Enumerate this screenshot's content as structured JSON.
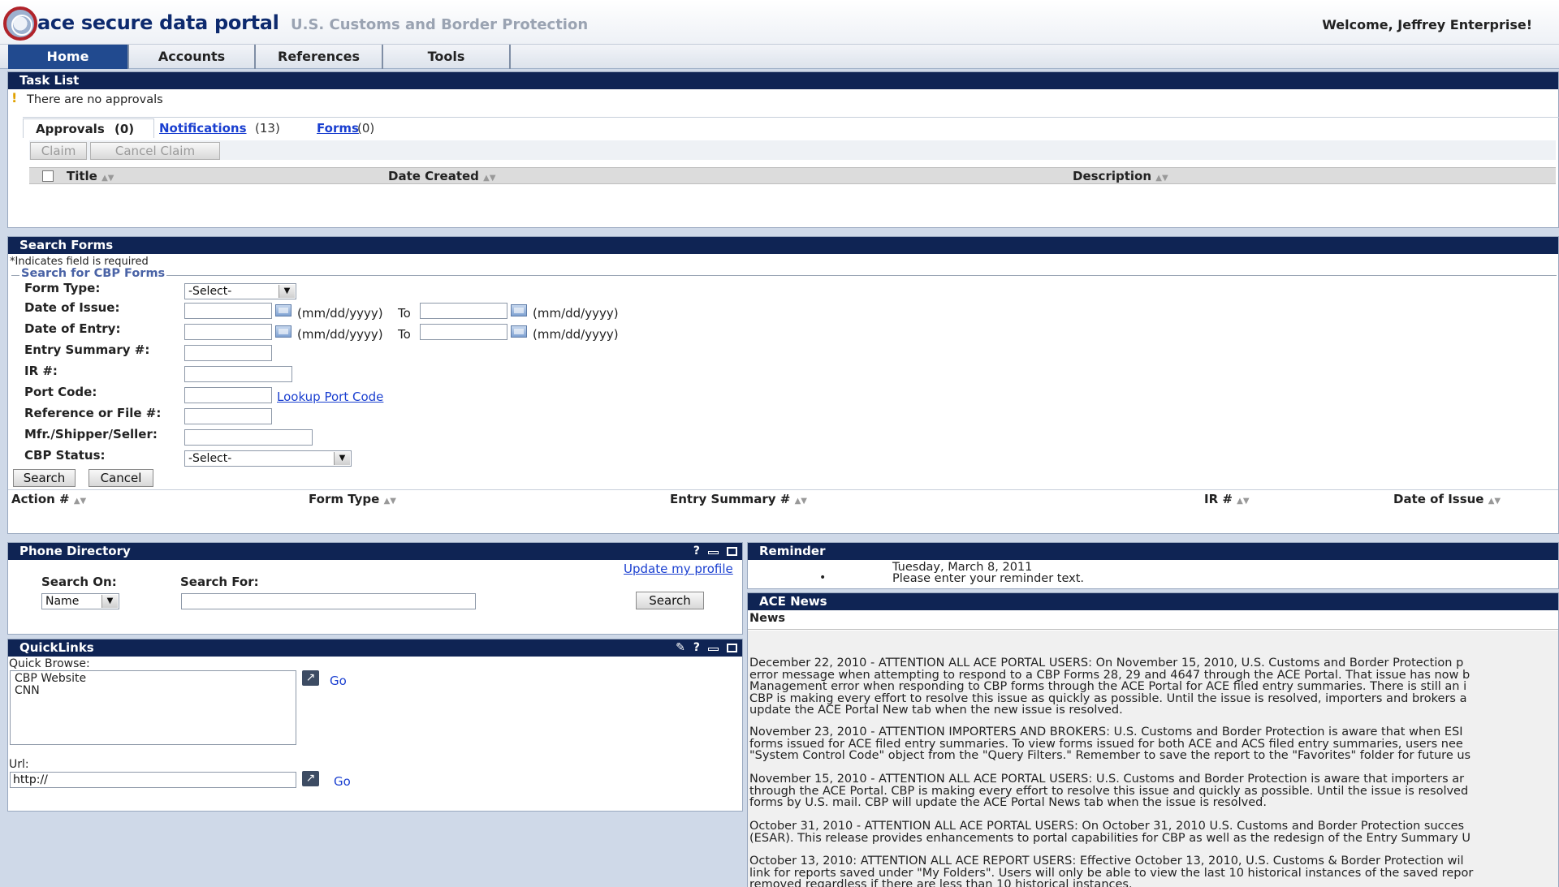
{
  "header": {
    "app_title": "ace secure data portal",
    "app_subtitle": "U.S. Customs and Border Protection",
    "welcome": "Welcome, Jeffrey Enterprise!"
  },
  "nav": {
    "tabs": [
      "Home",
      "Accounts",
      "References",
      "Tools"
    ],
    "active": "Home"
  },
  "task_list": {
    "title": "Task List",
    "status": "There are no approvals",
    "tabs": [
      {
        "label": "Approvals",
        "count": "(0)"
      },
      {
        "label": "Notifications",
        "count": " (13)"
      },
      {
        "label": "Forms",
        "count": " (0)"
      }
    ],
    "buttons": {
      "claim": "Claim",
      "cancel_claim": "Cancel Claim"
    },
    "columns": [
      "Title",
      "Date Created",
      "Description"
    ]
  },
  "search_forms": {
    "title": "Search Forms",
    "required_note": "*Indicates field is required",
    "fieldset_legend": "Search for CBP Forms",
    "labels": {
      "form_type": "Form Type:",
      "date_of_issue": "Date of Issue:",
      "date_of_entry": "Date of Entry:",
      "entry_summary": "Entry Summary #:",
      "ir": "IR #:",
      "port_code": "Port Code:",
      "reference": "Reference or File #:",
      "mfr": "Mfr./Shipper/Seller:",
      "cbp_status": "CBP Status:"
    },
    "form_type_value": "-Select-",
    "cbp_status_value": "-Select-",
    "date_format": "(mm/dd/yyyy)",
    "to": "To",
    "lookup_link": "Lookup Port Code",
    "buttons": {
      "search": "Search",
      "cancel": "Cancel"
    },
    "columns": [
      "Action #",
      "Form Type",
      "Entry Summary #",
      "IR #",
      "Date of Issue"
    ]
  },
  "phone_directory": {
    "title": "Phone Directory",
    "help": "?",
    "update_link": "Update my profile",
    "search_on_label": "Search On:",
    "search_for_label": "Search For:",
    "search_on_value": "Name",
    "search_button": "Search"
  },
  "quicklinks": {
    "title": "QuickLinks",
    "help": "?",
    "quick_browse_label": "Quick Browse:",
    "items": [
      "CBP Website",
      "CNN"
    ],
    "go": "Go",
    "url_label": "Url:",
    "url_value": "http://"
  },
  "reminder": {
    "title": "Reminder",
    "date": "Tuesday, March 8, 2011",
    "bullet": "•",
    "text": "Please enter your reminder text."
  },
  "ace_news": {
    "title": "ACE News",
    "subheader": "News",
    "paragraphs": [
      "December 22, 2010 - ATTENTION ALL ACE PORTAL USERS: On November 15, 2010, U.S. Customs and Border Protection p\nerror message when attempting to respond to a CBP Forms 28, 29 and 4647 through the ACE Portal. That issue has now b\nManagement error when responding to CBP forms through the ACE Portal for ACE filed entry summaries. There is still an i\nCBP is making every effort to resolve this issue as quickly as possible. Until the issue is resolved, importers and brokers a\nupdate the ACE Portal New tab when the new issue is resolved.",
      "November 23, 2010 - ATTENTION IMPORTERS AND BROKERS: U.S. Customs and Border Protection is aware that when ESI\nforms issued for ACE filed entry summaries. To view forms issued for both ACE and ACS filed entry summaries, users nee\n\"System Control Code\" object from the \"Query Filters.\" Remember to save the report to the \"Favorites\" folder for future us",
      "November 15, 2010 - ATTENTION ALL ACE PORTAL USERS: U.S. Customs and Border Protection is aware that importers ar\nthrough the ACE Portal. CBP is making every effort to resolve this issue and quickly as possible. Until the issue is resolved\nforms by U.S. mail. CBP will update the ACE Portal News tab when the issue is resolved.",
      "October 31, 2010 - ATTENTION ALL ACE PORTAL USERS: On October 31, 2010 U.S. Customs and Border Protection succes\n(ESAR). This release provides enhancements to portal capabilities for CBP as well as the redesign of the Entry Summary U",
      "October 13, 2010: ATTENTION ALL ACE REPORT USERS: Effective October 13, 2010, U.S. Customs & Border Protection wil\nlink for reports saved under \"My Folders\". Users will only be able to view the last 10 historical instances of the saved repor\nremoved regardless if there are less than 10 historical instances."
    ]
  }
}
